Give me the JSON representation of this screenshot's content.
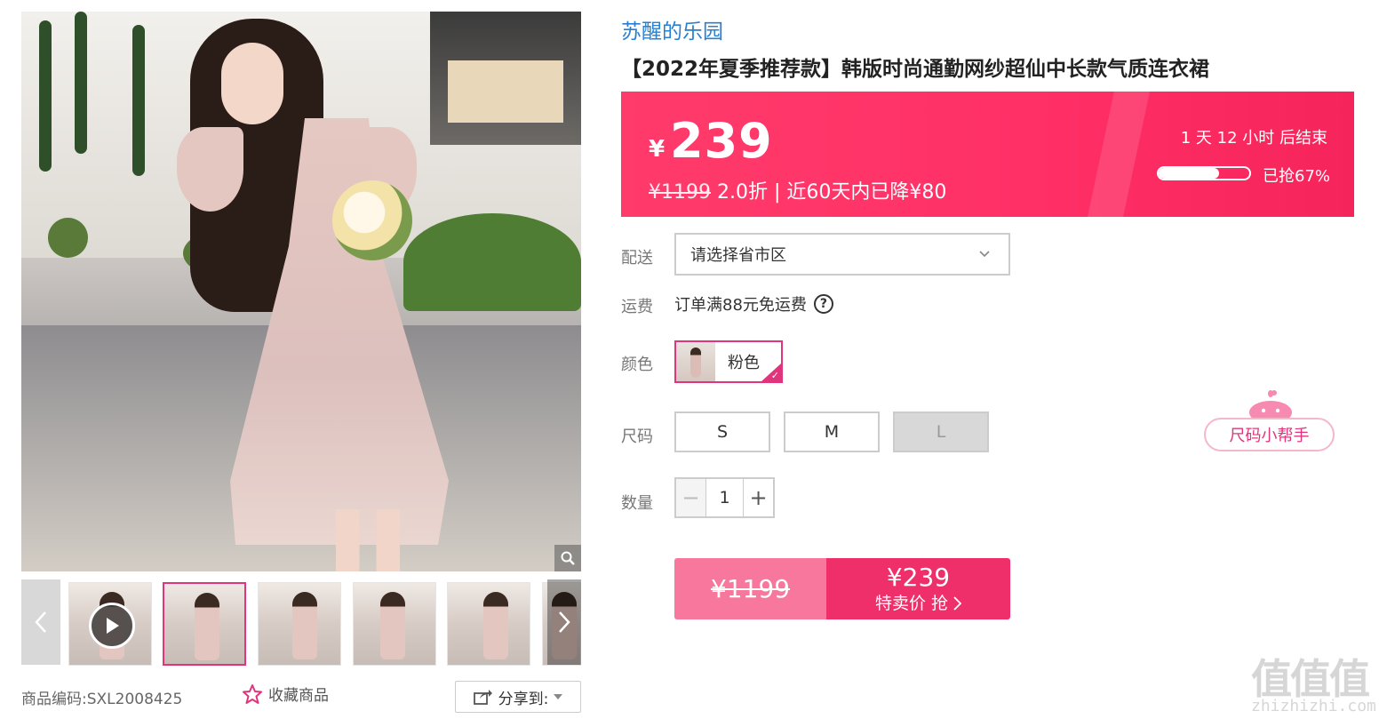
{
  "gallery": {
    "thumbnail_count": 6,
    "active_thumbnail_index": 1,
    "meta": {
      "sku_label": "商品编码:",
      "sku_value": "SXL2008425",
      "favorite_label": "收藏商品",
      "share_label": "分享到:"
    }
  },
  "product": {
    "store_name": "苏醒的乐园",
    "title": "【2022年夏季推荐款】韩版时尚通勤网纱超仙中长款气质连衣裙"
  },
  "price_bar": {
    "currency": "¥",
    "price": "239",
    "original_price": "¥1199",
    "discount_text": "2.0折 | 近60天内已降¥80",
    "countdown_text": "1 天 12 小时 后结束",
    "sold_fraction": 0.67,
    "sold_text": "已抢67%",
    "colors": {
      "bar": "#ff2f66"
    }
  },
  "options": {
    "delivery_label": "配送",
    "delivery_placeholder": "请选择省市区",
    "shipping_label": "运费",
    "shipping_text": "订单满88元免运费",
    "shipping_help_icon": "?",
    "color_label": "颜色",
    "color_value": "粉色",
    "size_label": "尺码",
    "sizes": [
      {
        "label": "S",
        "disabled": false
      },
      {
        "label": "M",
        "disabled": false
      },
      {
        "label": "L",
        "disabled": true
      }
    ],
    "quantity_label": "数量",
    "quantity_value": "1",
    "size_helper_label": "尺码小帮手"
  },
  "buy": {
    "original_price": "¥1199",
    "price": "¥239",
    "action_label": "特卖价 抢",
    "colors": {
      "left": "#f7779d",
      "right": "#ef2f6a"
    }
  },
  "watermark": {
    "chars": "值值值",
    "url": "zhizhizhi.com"
  },
  "icons": {
    "zoom": "magnifier-icon",
    "play": "play-icon",
    "prev": "chevron-left-icon",
    "next": "chevron-right-icon",
    "favorite": "star-outline-icon",
    "share": "share-icon",
    "dropdown": "chevron-down-icon",
    "help": "question-circle-icon",
    "buy_arrow": "chevron-right-icon"
  }
}
